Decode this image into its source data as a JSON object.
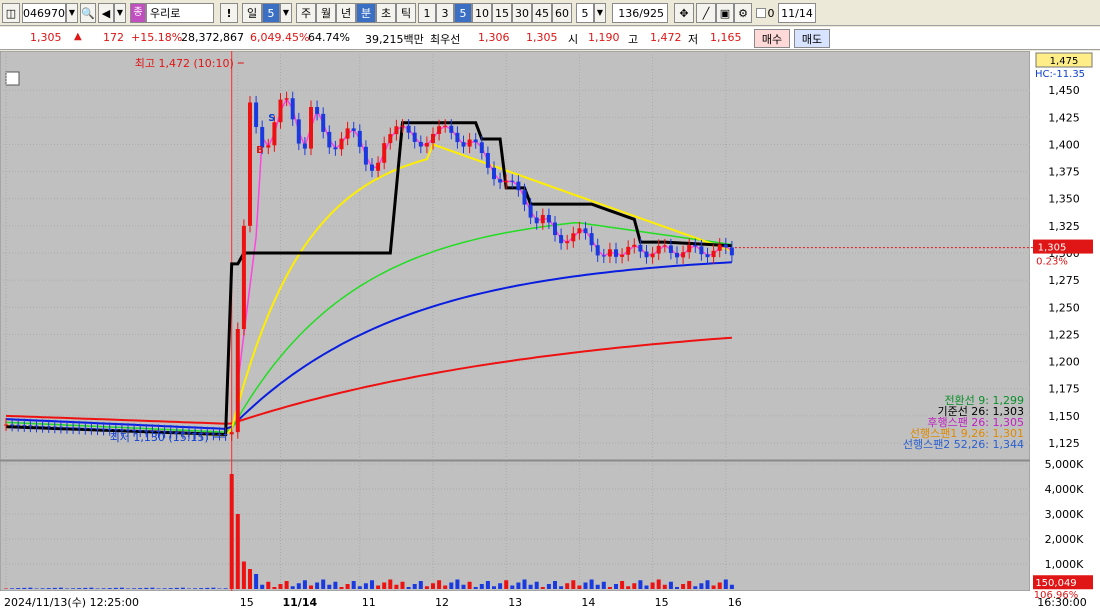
{
  "toolbar": {
    "code": "046970",
    "name": "우리로",
    "name_badge": "종",
    "warn": "!",
    "period_day": "일",
    "period_num": "5",
    "period_week": "주",
    "period_month": "월",
    "period_year": "년",
    "period_min": "분",
    "period_sec": "초",
    "period_tick": "틱",
    "intervals": [
      "1",
      "3",
      "5",
      "10",
      "15",
      "30",
      "45",
      "60"
    ],
    "interval_sel": "5",
    "interval_val": "5",
    "count": "136",
    "count_total": "/925",
    "toggle_label": "0",
    "date": "11/14"
  },
  "quote": {
    "price": "1,305",
    "change": "172",
    "change_pct": "+15.18%",
    "volume": "28,372,867",
    "vol_ratio": "6,049.45%",
    "turnover": "64.74%",
    "amount": "39,215백만",
    "best_label": "최우선",
    "best_sell": "1,306",
    "best_buy": "1,305",
    "open_label": "시",
    "open": "1,190",
    "high_label": "고",
    "high": "1,472",
    "low_label": "저",
    "low": "1,165",
    "buy_btn": "매수",
    "sell_btn": "매도"
  },
  "chart_data": {
    "type": "candlestick",
    "price_axis": {
      "ylim": [
        1125,
        1475
      ],
      "ticks": [
        1125,
        1150,
        1175,
        1200,
        1225,
        1250,
        1275,
        1300,
        1325,
        1350,
        1375,
        1400,
        1425,
        1450
      ],
      "tick_labels": [
        "1,125",
        "1,150",
        "1,175",
        "1,200",
        "1,225",
        "1,250",
        "1,275",
        "1,300",
        "1,325",
        "1,350",
        "1,375",
        "1,400",
        "1,425",
        "1,450"
      ]
    },
    "volume_axis": {
      "ylim": [
        0,
        5000000
      ],
      "ticks": [
        1000000,
        2000000,
        3000000,
        4000000,
        5000000
      ],
      "tick_labels": [
        "1,000K",
        "2,000K",
        "3,000K",
        "4,000K",
        "5,000K"
      ]
    },
    "top_box": "1,475",
    "top_sub": "HC:-11.35",
    "current_price_box": "1,305",
    "current_pct": "0.23%",
    "current_price": 1305,
    "volume_box": "150,049",
    "volume_pct": "106.96%",
    "current_volume": 150049,
    "high_annotation": "최고 1,472 (10:10)",
    "low_annotation": "최저 1,130 (15:15)",
    "signal_b": "B",
    "signal_s": "S",
    "x_labels": [
      {
        "label": "2024/11/13(수) 12:25:00",
        "i": 0
      },
      {
        "label": "15",
        "i": 38
      },
      {
        "label": "11/14",
        "i": 45
      },
      {
        "label": "11",
        "i": 58
      },
      {
        "label": "12",
        "i": 70
      },
      {
        "label": "13",
        "i": 82
      },
      {
        "label": "14",
        "i": 94
      },
      {
        "label": "15",
        "i": 106
      },
      {
        "label": "16",
        "i": 118
      }
    ],
    "x_right_label": "16:30:00",
    "legend": [
      {
        "text": "전환선 9: 1,299",
        "color": "#0a8f2a"
      },
      {
        "text": "기준선 26: 1,303",
        "color": "#000000"
      },
      {
        "text": "후행스팬 26: 1,305",
        "color": "#c020c0"
      },
      {
        "text": "선행스팬1 9,26: 1,301",
        "color": "#e08a00"
      },
      {
        "text": "선행스팬2 52,26: 1,344",
        "color": "#2a60d0"
      }
    ],
    "series": [
      {
        "name": "ma_yellow",
        "color": "#ffee00",
        "values": [
          1135,
          1134,
          1134,
          1133,
          1132,
          1132,
          1132,
          1131,
          1131,
          1131,
          1131,
          1131,
          1131,
          1131,
          1131,
          1131,
          1132,
          1132,
          1132,
          1132,
          1132,
          1132,
          1132,
          1133,
          1133,
          1133,
          1133,
          1133,
          1133,
          1133,
          1133,
          1133,
          1133,
          1133,
          1133,
          1133,
          1133,
          1133,
          1133,
          1133,
          1133,
          1133,
          1133,
          1133,
          1133,
          1133,
          1133,
          1133,
          1133,
          1133,
          1133,
          1133,
          1133,
          1133,
          1133,
          1134,
          1134,
          1134,
          1135,
          1135,
          1135,
          1136,
          1136,
          1136,
          1137,
          1137,
          1137,
          1138,
          1138,
          1138,
          1139,
          1139,
          1140,
          1140,
          1141,
          1141,
          1142,
          1142,
          1143,
          1143,
          1144,
          1144,
          1145,
          1145,
          1146,
          1146,
          1147,
          1147,
          1147,
          1148,
          1148,
          1148,
          1148,
          1149,
          1149,
          1150,
          1151,
          1150,
          1151,
          1166,
          1222,
          1262,
          1296,
          1313,
          1325,
          1335,
          1345,
          1355,
          1361,
          1363,
          1366,
          1368,
          1370,
          1371,
          1371,
          1372,
          1375,
          1378,
          1380,
          1381,
          1383,
          1385,
          1386,
          1387,
          1387,
          1388,
          1388,
          1388,
          1388,
          1388,
          1388,
          1388,
          1388,
          1388,
          1388,
          1388,
          1388,
          1388,
          1388,
          1388,
          1388,
          1387,
          1386,
          1385,
          1384,
          1383,
          1382,
          1381,
          1380,
          1378,
          1377,
          1375,
          1374,
          1372,
          1371,
          1369,
          1368,
          1366,
          1364,
          1362,
          1361,
          1360,
          1359,
          1358,
          1357,
          1356,
          1355,
          1353,
          1352,
          1350,
          1349,
          1348,
          1347,
          1346,
          1345,
          1344,
          1342,
          1341,
          1340,
          1339,
          1337,
          1336,
          1335,
          1334,
          1334,
          1333,
          1332,
          1331,
          1330,
          1329,
          1328,
          1327,
          1326,
          1325,
          1324,
          1324,
          1323,
          1322,
          1321,
          1320,
          1319,
          1318,
          1318,
          1317,
          1316,
          1316,
          1315,
          1315,
          1314,
          1314,
          1313,
          1313,
          1312,
          1312,
          1311,
          1311,
          1310,
          1310,
          1310,
          1309,
          1309,
          1309,
          1309,
          1308,
          1308
        ]
      },
      {
        "name": "ma_green",
        "color": "#22dd22",
        "values": []
      },
      {
        "name": "ma_blue",
        "color": "#0a1ee0",
        "values": []
      },
      {
        "name": "ma_red",
        "color": "#ee1111",
        "values": []
      }
    ]
  }
}
